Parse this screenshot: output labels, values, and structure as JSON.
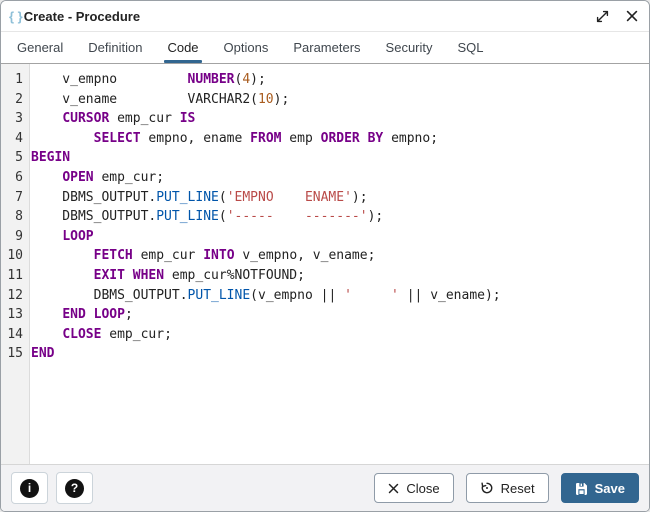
{
  "window": {
    "icon_text": "{ }",
    "title": "Create - Procedure"
  },
  "tabs": [
    {
      "label": "General",
      "active": false
    },
    {
      "label": "Definition",
      "active": false
    },
    {
      "label": "Code",
      "active": true
    },
    {
      "label": "Options",
      "active": false
    },
    {
      "label": "Parameters",
      "active": false
    },
    {
      "label": "Security",
      "active": false
    },
    {
      "label": "SQL",
      "active": false
    }
  ],
  "editor": {
    "lines": [
      {
        "no": 1,
        "segs": [
          [
            "plain",
            "    v_empno         "
          ],
          [
            "kw",
            "NUMBER"
          ],
          [
            "plain",
            "("
          ],
          [
            "num",
            "4"
          ],
          [
            "plain",
            ");"
          ]
        ]
      },
      {
        "no": 2,
        "segs": [
          [
            "plain",
            "    v_ename         VARCHAR2("
          ],
          [
            "num",
            "10"
          ],
          [
            "plain",
            ");"
          ]
        ]
      },
      {
        "no": 3,
        "segs": [
          [
            "plain",
            "    "
          ],
          [
            "kw",
            "CURSOR"
          ],
          [
            "plain",
            " emp_cur "
          ],
          [
            "kw",
            "IS"
          ]
        ]
      },
      {
        "no": 4,
        "segs": [
          [
            "plain",
            "        "
          ],
          [
            "kw",
            "SELECT"
          ],
          [
            "plain",
            " empno, ename "
          ],
          [
            "kw",
            "FROM"
          ],
          [
            "plain",
            " emp "
          ],
          [
            "kw",
            "ORDER BY"
          ],
          [
            "plain",
            " empno;"
          ]
        ]
      },
      {
        "no": 5,
        "segs": [
          [
            "kw",
            "BEGIN"
          ]
        ]
      },
      {
        "no": 6,
        "segs": [
          [
            "plain",
            "    "
          ],
          [
            "kw",
            "OPEN"
          ],
          [
            "plain",
            " emp_cur;"
          ]
        ]
      },
      {
        "no": 7,
        "segs": [
          [
            "plain",
            "    DBMS_OUTPUT."
          ],
          [
            "fn",
            "PUT_LINE"
          ],
          [
            "plain",
            "("
          ],
          [
            "str",
            "'EMPNO    ENAME'"
          ],
          [
            "plain",
            ");"
          ]
        ]
      },
      {
        "no": 8,
        "segs": [
          [
            "plain",
            "    DBMS_OUTPUT."
          ],
          [
            "fn",
            "PUT_LINE"
          ],
          [
            "plain",
            "("
          ],
          [
            "str",
            "'-----    -------'"
          ],
          [
            "plain",
            ");"
          ]
        ]
      },
      {
        "no": 9,
        "segs": [
          [
            "plain",
            "    "
          ],
          [
            "kw",
            "LOOP"
          ]
        ]
      },
      {
        "no": 10,
        "segs": [
          [
            "plain",
            "        "
          ],
          [
            "kw",
            "FETCH"
          ],
          [
            "plain",
            " emp_cur "
          ],
          [
            "kw",
            "INTO"
          ],
          [
            "plain",
            " v_empno, v_ename;"
          ]
        ]
      },
      {
        "no": 11,
        "segs": [
          [
            "plain",
            "        "
          ],
          [
            "kw",
            "EXIT"
          ],
          [
            "plain",
            " "
          ],
          [
            "kw",
            "WHEN"
          ],
          [
            "plain",
            " emp_cur%NOTFOUND;"
          ]
        ]
      },
      {
        "no": 12,
        "segs": [
          [
            "plain",
            "        DBMS_OUTPUT."
          ],
          [
            "fn",
            "PUT_LINE"
          ],
          [
            "plain",
            "(v_empno || "
          ],
          [
            "str",
            "'     '"
          ],
          [
            "plain",
            " || v_ename);"
          ]
        ]
      },
      {
        "no": 13,
        "segs": [
          [
            "plain",
            "    "
          ],
          [
            "kw",
            "END LOOP"
          ],
          [
            "plain",
            ";"
          ]
        ]
      },
      {
        "no": 14,
        "segs": [
          [
            "plain",
            "    "
          ],
          [
            "kw",
            "CLOSE"
          ],
          [
            "plain",
            " emp_cur;"
          ]
        ]
      },
      {
        "no": 15,
        "segs": [
          [
            "kw",
            "END"
          ]
        ]
      }
    ]
  },
  "footer": {
    "close_label": "Close",
    "reset_label": "Reset",
    "save_label": "Save"
  },
  "colors": {
    "accent": "#326690",
    "keyword": "#770088",
    "number": "#a95c1f",
    "string": "#b94a48",
    "function": "#0055aa"
  }
}
